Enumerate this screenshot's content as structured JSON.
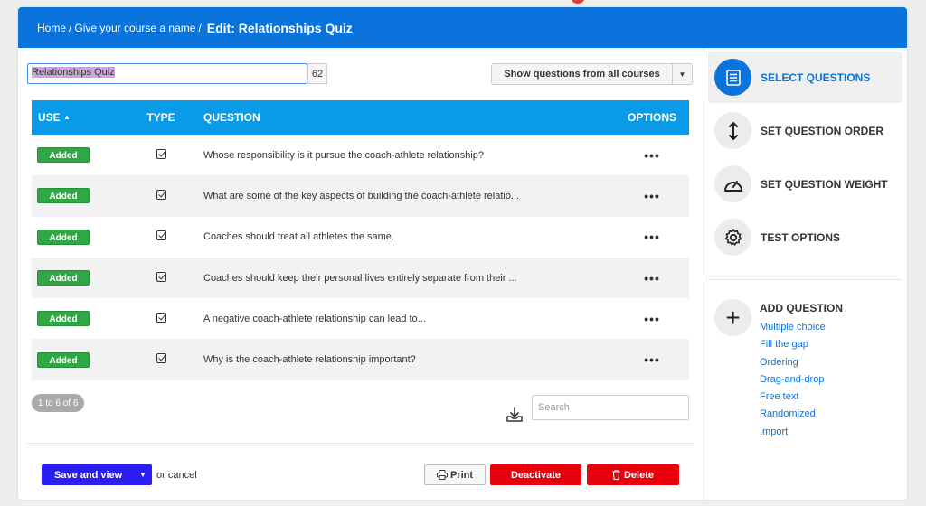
{
  "breadcrumb": {
    "home": "Home",
    "course": "Give your course a name",
    "current": "Edit: Relationships Quiz"
  },
  "quiz": {
    "title": "Relationships Quiz",
    "char_count": "62",
    "filter_label": "Show questions from all courses"
  },
  "table": {
    "headers": {
      "use": "USE",
      "sort_indicator": "▲",
      "type": "TYPE",
      "question": "QUESTION",
      "options": "OPTIONS"
    },
    "rows": [
      {
        "status": "Added",
        "type": "checkbox-icon",
        "question": "Whose responsibility is it pursue the coach-athlete relationship?",
        "options": "•••"
      },
      {
        "status": "Added",
        "type": "checkbox-icon",
        "question": "What are some of the key aspects of building the coach-athlete relatio...",
        "options": "•••"
      },
      {
        "status": "Added",
        "type": "checkbox-icon",
        "question": "Coaches should treat all athletes the same.",
        "options": "•••"
      },
      {
        "status": "Added",
        "type": "checkbox-icon",
        "question": "Coaches should keep their personal lives entirely separate from their ...",
        "options": "•••"
      },
      {
        "status": "Added",
        "type": "checkbox-icon",
        "question": "A negative coach-athlete relationship can lead to...",
        "options": "•••"
      },
      {
        "status": "Added",
        "type": "checkbox-icon",
        "question": "Why is the coach-athlete relationship important?",
        "options": "•••"
      }
    ],
    "pagination": "1 to 6 of 6",
    "search_placeholder": "Search"
  },
  "footer": {
    "save_label": "Save and view",
    "or_cancel": "or cancel",
    "print_label": "Print",
    "deactivate_label": "Deactivate",
    "delete_label": "Delete"
  },
  "sidebar": {
    "steps": [
      {
        "label": "SELECT QUESTIONS",
        "icon": "list-icon",
        "active": true
      },
      {
        "label": "SET QUESTION ORDER",
        "icon": "vertical-arrows-icon",
        "active": false
      },
      {
        "label": "SET QUESTION WEIGHT",
        "icon": "gauge-icon",
        "active": false
      },
      {
        "label": "TEST OPTIONS",
        "icon": "gear-icon",
        "active": false
      }
    ],
    "add_question": {
      "title": "ADD QUESTION",
      "plus": "+",
      "types": [
        "Multiple choice",
        "Fill the gap",
        "Ordering",
        "Drag-and-drop",
        "Free text",
        "Randomized",
        "Import"
      ]
    }
  },
  "colors": {
    "header": "#0a73dc",
    "table_header": "#0a9be8",
    "added": "#2fa844",
    "save": "#2a1ff0",
    "danger": "#e8000b"
  }
}
